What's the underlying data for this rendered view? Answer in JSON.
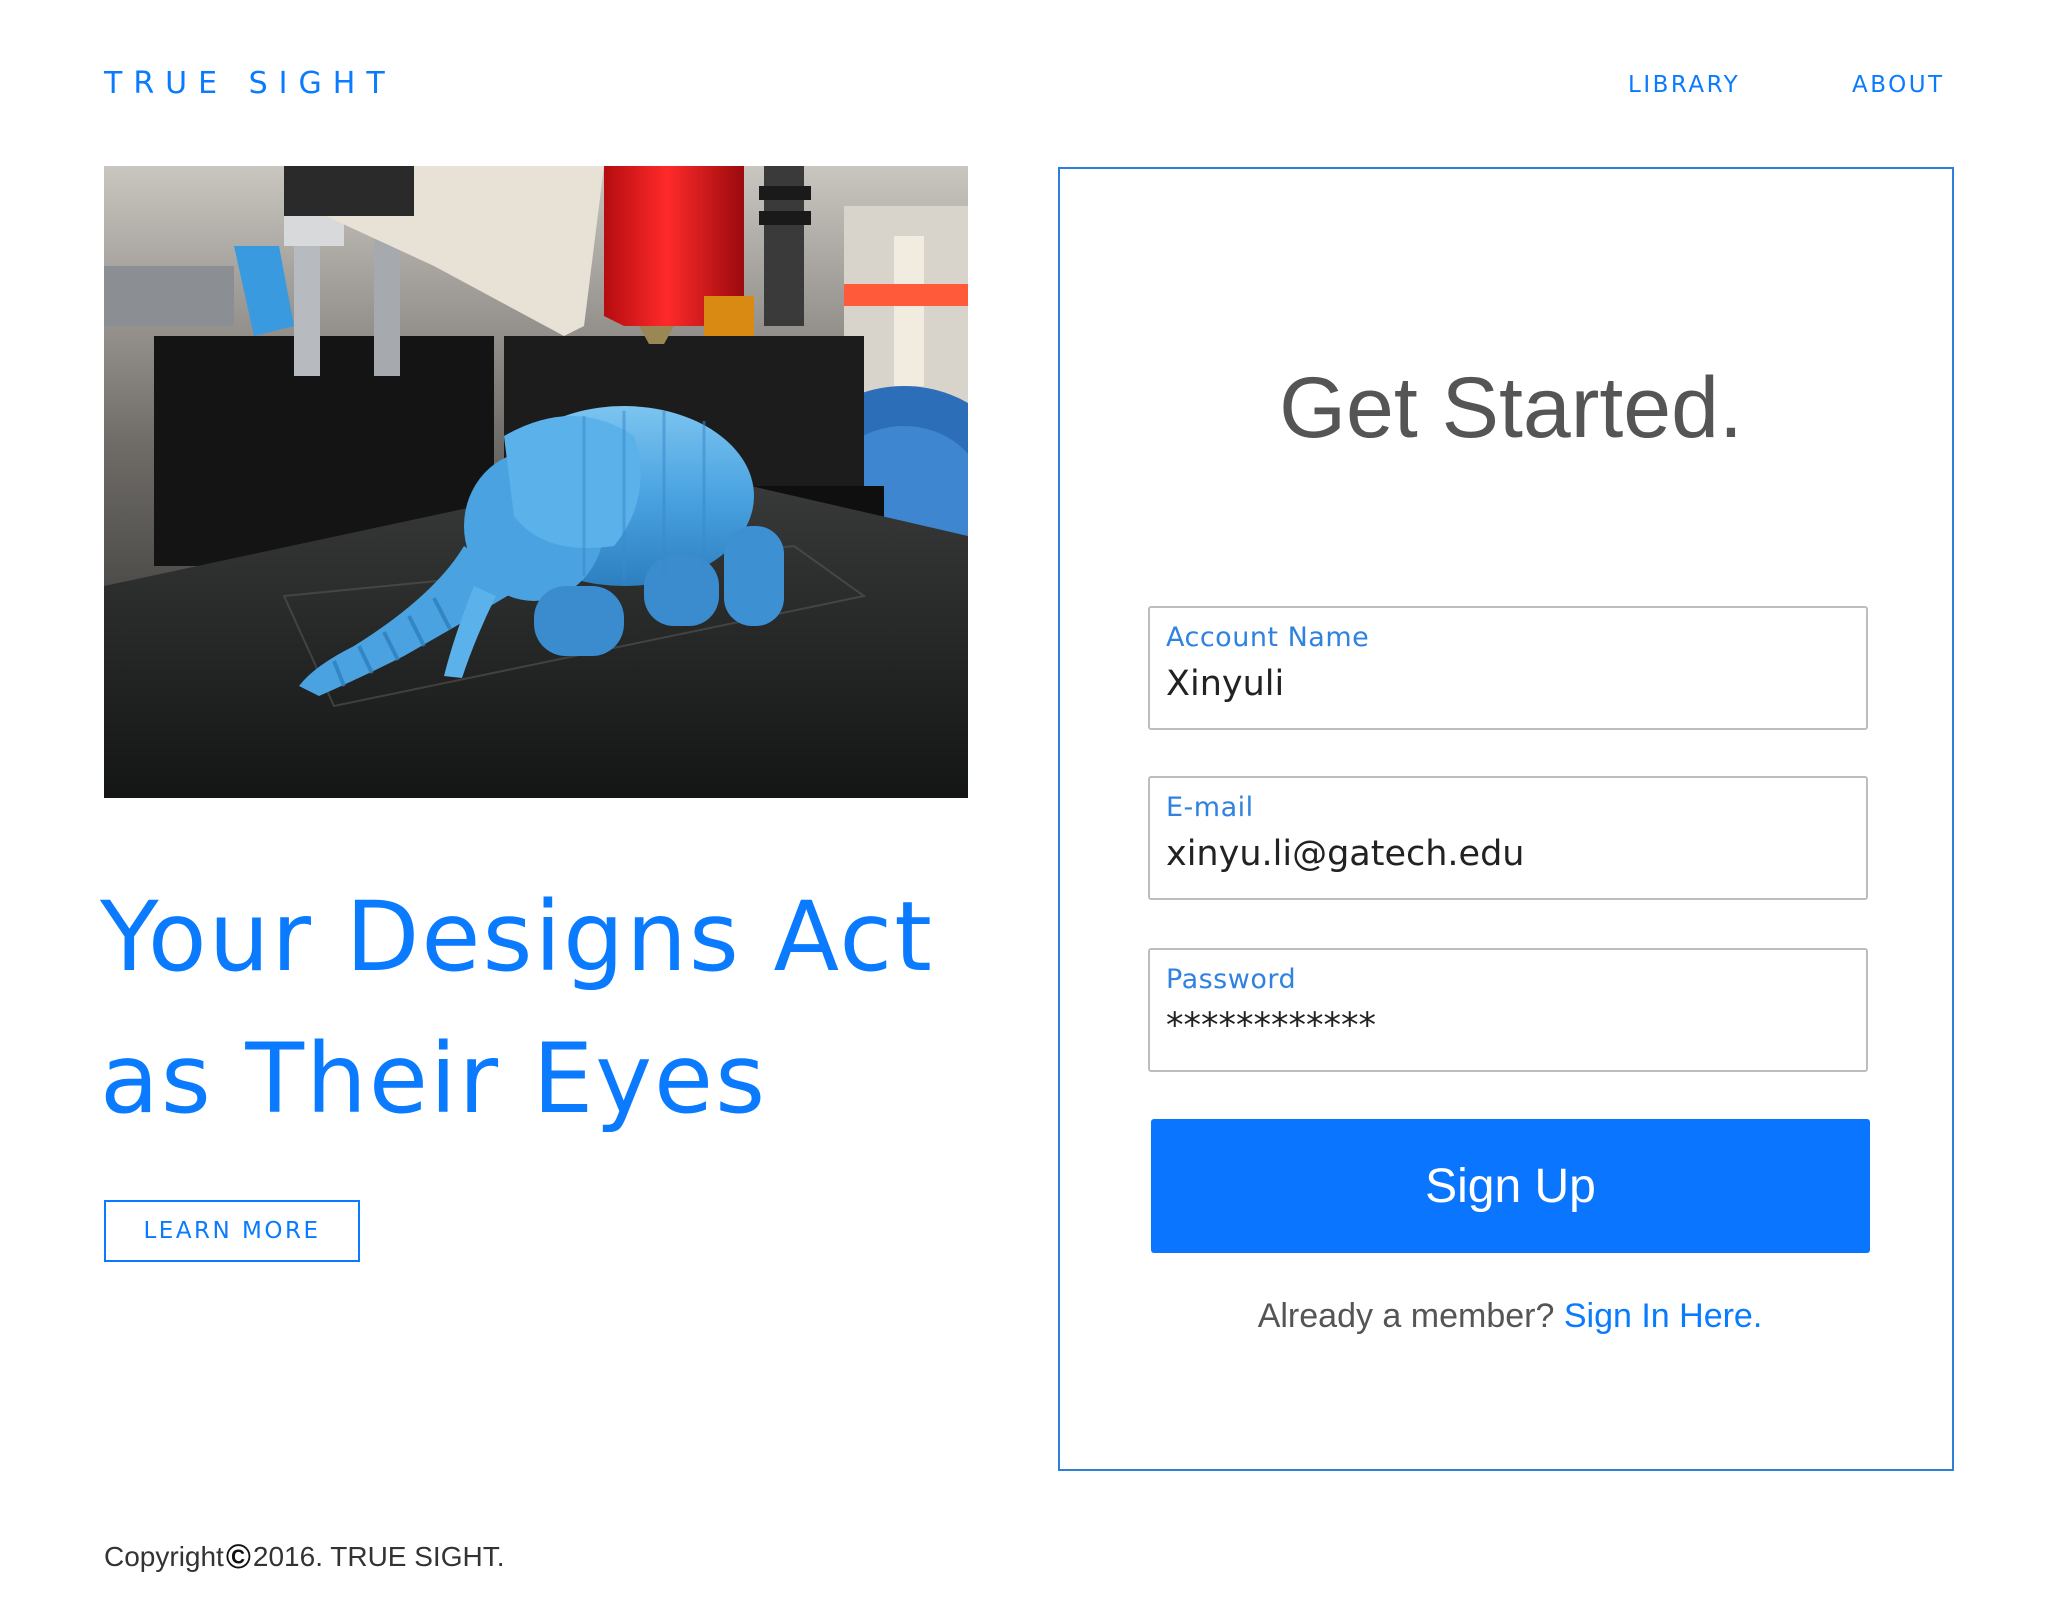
{
  "header": {
    "brand": "TRUE SIGHT",
    "nav": [
      {
        "label": "LIBRARY"
      },
      {
        "label": "ABOUT"
      }
    ]
  },
  "hero": {
    "photo_icon": "3d-printed-elephant-photo",
    "headline_line1": "Your Designs Act",
    "headline_line2": "as Their Eyes",
    "learn_more_label": "LEARN MORE"
  },
  "signup": {
    "title": "Get Started.",
    "fields": [
      {
        "label": "Account Name",
        "value": "Xinyuli",
        "type": "text"
      },
      {
        "label": "E-mail",
        "value": "xinyu.li@gatech.edu",
        "type": "email"
      },
      {
        "label": "Password",
        "value": "************",
        "type": "password"
      }
    ],
    "submit_label": "Sign Up",
    "member_prompt": "Already a member?",
    "signin_link": "Sign In Here."
  },
  "footer": {
    "copyright_prefix": "Copyright",
    "copyright_symbol": "©",
    "copyright_suffix": "2016. TRUE SIGHT."
  },
  "colors": {
    "accent": "#0a7aff",
    "button": "#0a75ff",
    "card_border": "#2f7fd8",
    "field_border": "#bdbdbd",
    "muted_text": "#555555"
  }
}
